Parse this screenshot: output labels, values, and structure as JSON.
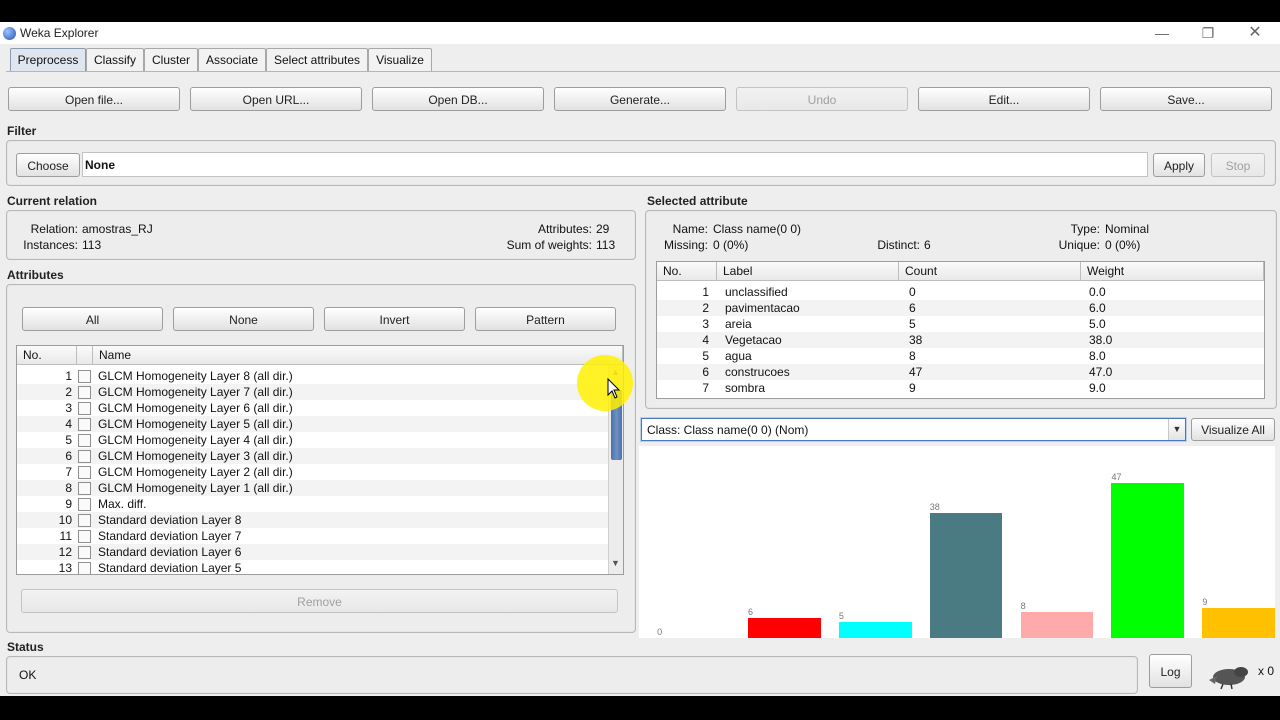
{
  "window": {
    "title": "Weka Explorer"
  },
  "tabs": [
    "Preprocess",
    "Classify",
    "Cluster",
    "Associate",
    "Select attributes",
    "Visualize"
  ],
  "toolbar": {
    "open_file": "Open file...",
    "open_url": "Open URL...",
    "open_db": "Open DB...",
    "generate": "Generate...",
    "undo": "Undo",
    "edit": "Edit...",
    "save": "Save..."
  },
  "filter": {
    "label": "Filter",
    "choose": "Choose",
    "value": "None",
    "apply": "Apply",
    "stop": "Stop"
  },
  "current_relation": {
    "label": "Current relation",
    "relation_label": "Relation:",
    "relation": "amostras_RJ",
    "instances_label": "Instances:",
    "instances": "113",
    "attributes_label": "Attributes:",
    "attributes": "29",
    "sow_label": "Sum of weights:",
    "sow": "113"
  },
  "attributes": {
    "label": "Attributes",
    "buttons": {
      "all": "All",
      "none": "None",
      "invert": "Invert",
      "pattern": "Pattern"
    },
    "col_no": "No.",
    "col_name": "Name",
    "rows": [
      {
        "no": "1",
        "name": "GLCM Homogeneity Layer 8 (all dir.)"
      },
      {
        "no": "2",
        "name": "GLCM Homogeneity Layer 7 (all dir.)"
      },
      {
        "no": "3",
        "name": "GLCM Homogeneity Layer 6 (all dir.)"
      },
      {
        "no": "4",
        "name": "GLCM Homogeneity Layer 5 (all dir.)"
      },
      {
        "no": "5",
        "name": "GLCM Homogeneity Layer 4 (all dir.)"
      },
      {
        "no": "6",
        "name": "GLCM Homogeneity Layer 3 (all dir.)"
      },
      {
        "no": "7",
        "name": "GLCM Homogeneity Layer 2 (all dir.)"
      },
      {
        "no": "8",
        "name": "GLCM Homogeneity Layer 1 (all dir.)"
      },
      {
        "no": "9",
        "name": "Max. diff."
      },
      {
        "no": "10",
        "name": "Standard deviation Layer 8"
      },
      {
        "no": "11",
        "name": "Standard deviation Layer 7"
      },
      {
        "no": "12",
        "name": "Standard deviation Layer 6"
      },
      {
        "no": "13",
        "name": "Standard deviation Layer 5"
      }
    ],
    "remove": "Remove"
  },
  "selected_attribute": {
    "label": "Selected attribute",
    "name_label": "Name:",
    "name": "Class name(0 0)",
    "type_label": "Type:",
    "type": "Nominal",
    "missing_label": "Missing:",
    "missing": "0 (0%)",
    "distinct_label": "Distinct:",
    "distinct": "6",
    "unique_label": "Unique:",
    "unique": "0 (0%)",
    "columns": [
      "No.",
      "Label",
      "Count",
      "Weight"
    ],
    "rows": [
      {
        "no": "1",
        "label": "unclassified",
        "count": "0",
        "weight": "0.0"
      },
      {
        "no": "2",
        "label": "pavimentacao",
        "count": "6",
        "weight": "6.0"
      },
      {
        "no": "3",
        "label": "areia",
        "count": "5",
        "weight": "5.0"
      },
      {
        "no": "4",
        "label": "Vegetacao",
        "count": "38",
        "weight": "38.0"
      },
      {
        "no": "5",
        "label": "agua",
        "count": "8",
        "weight": "8.0"
      },
      {
        "no": "6",
        "label": "construcoes",
        "count": "47",
        "weight": "47.0"
      },
      {
        "no": "7",
        "label": "sombra",
        "count": "9",
        "weight": "9.0"
      }
    ]
  },
  "class_selector": {
    "value": "Class: Class name(0 0) (Nom)",
    "visualize_all": "Visualize All"
  },
  "chart_data": {
    "type": "bar",
    "categories": [
      "unclassified",
      "pavimentacao",
      "areia",
      "Vegetacao",
      "agua",
      "construcoes",
      "sombra"
    ],
    "values": [
      0,
      6,
      5,
      38,
      8,
      47,
      9
    ],
    "colors": [
      "#0000ff",
      "#ff0000",
      "#00ffff",
      "#4a7a82",
      "#ffaaaa",
      "#00ff00",
      "#ffc000"
    ]
  },
  "status": {
    "label": "Status",
    "text": "OK",
    "log": "Log",
    "count": "x 0"
  },
  "icons": {
    "title": "weka-icon",
    "status": "weka-bird-icon"
  }
}
